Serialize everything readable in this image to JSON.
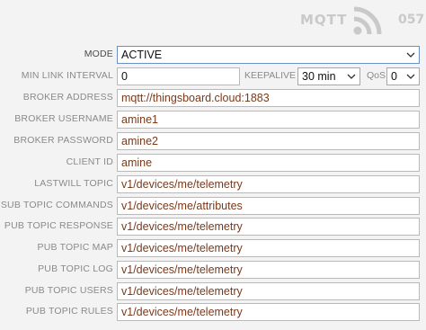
{
  "header": {
    "title": "MQTT",
    "icon": "wifi-signal-icon",
    "number": "057"
  },
  "form": {
    "mode": {
      "label": "MODE",
      "value": "ACTIVE"
    },
    "min_link_interval": {
      "label": "MIN LINK INTERVAL",
      "value": "0"
    },
    "keepalive": {
      "label": "KEEPALIVE",
      "value": "30 min"
    },
    "qos": {
      "label": "QoS",
      "value": "0"
    },
    "broker_address": {
      "label": "BROKER ADDRESS",
      "value": "mqtt://thingsboard.cloud:1883"
    },
    "broker_username": {
      "label": "BROKER USERNAME",
      "value": "amine1"
    },
    "broker_password": {
      "label": "BROKER PASSWORD",
      "value": "amine2"
    },
    "client_id": {
      "label": "CLIENT ID",
      "value": "amine"
    },
    "lastwill_topic": {
      "label": "LASTWILL TOPIC",
      "value": "v1/devices/me/telemetry"
    },
    "sub_topic_commands": {
      "label": "SUB TOPIC COMMANDS",
      "value": "v1/devices/me/attributes"
    },
    "pub_topic_response": {
      "label": "PUB TOPIC RESPONSE",
      "value": "v1/devices/me/telemetry"
    },
    "pub_topic_map": {
      "label": "PUB TOPIC MAP",
      "value": "v1/devices/me/telemetry"
    },
    "pub_topic_log": {
      "label": "PUB TOPIC LOG",
      "value": "v1/devices/me/telemetry"
    },
    "pub_topic_users": {
      "label": "PUB TOPIC USERS",
      "value": "v1/devices/me/telemetry"
    },
    "pub_topic_rules": {
      "label": "PUB TOPIC RULES",
      "value": "v1/devices/me/telemetry"
    }
  }
}
